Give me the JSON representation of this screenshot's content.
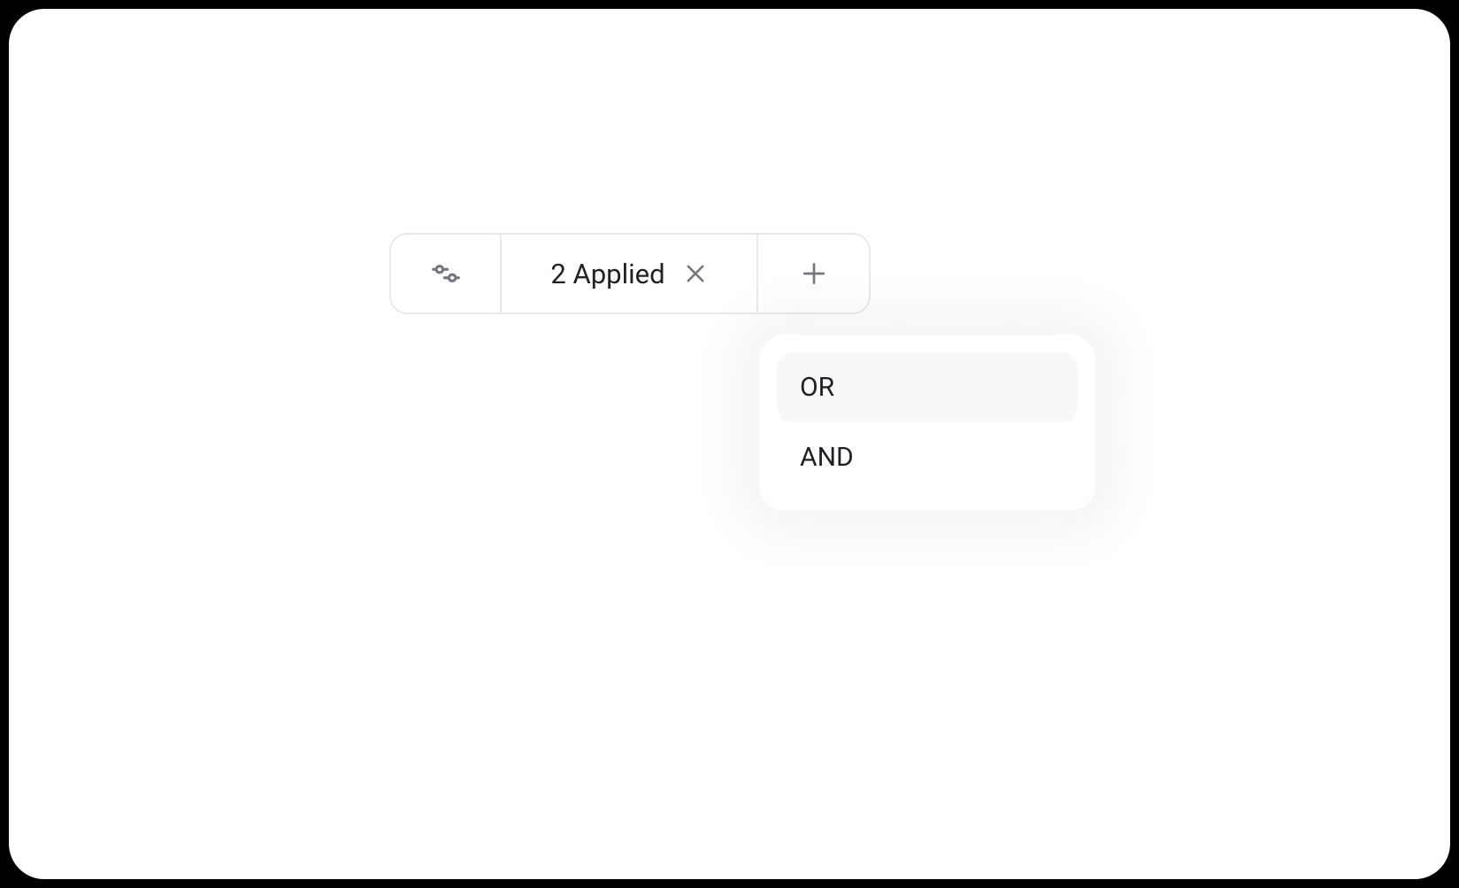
{
  "filter": {
    "applied_label": "2 Applied"
  },
  "dropdown": {
    "items": [
      {
        "label": "OR",
        "highlighted": true
      },
      {
        "label": "AND",
        "highlighted": false
      }
    ]
  }
}
